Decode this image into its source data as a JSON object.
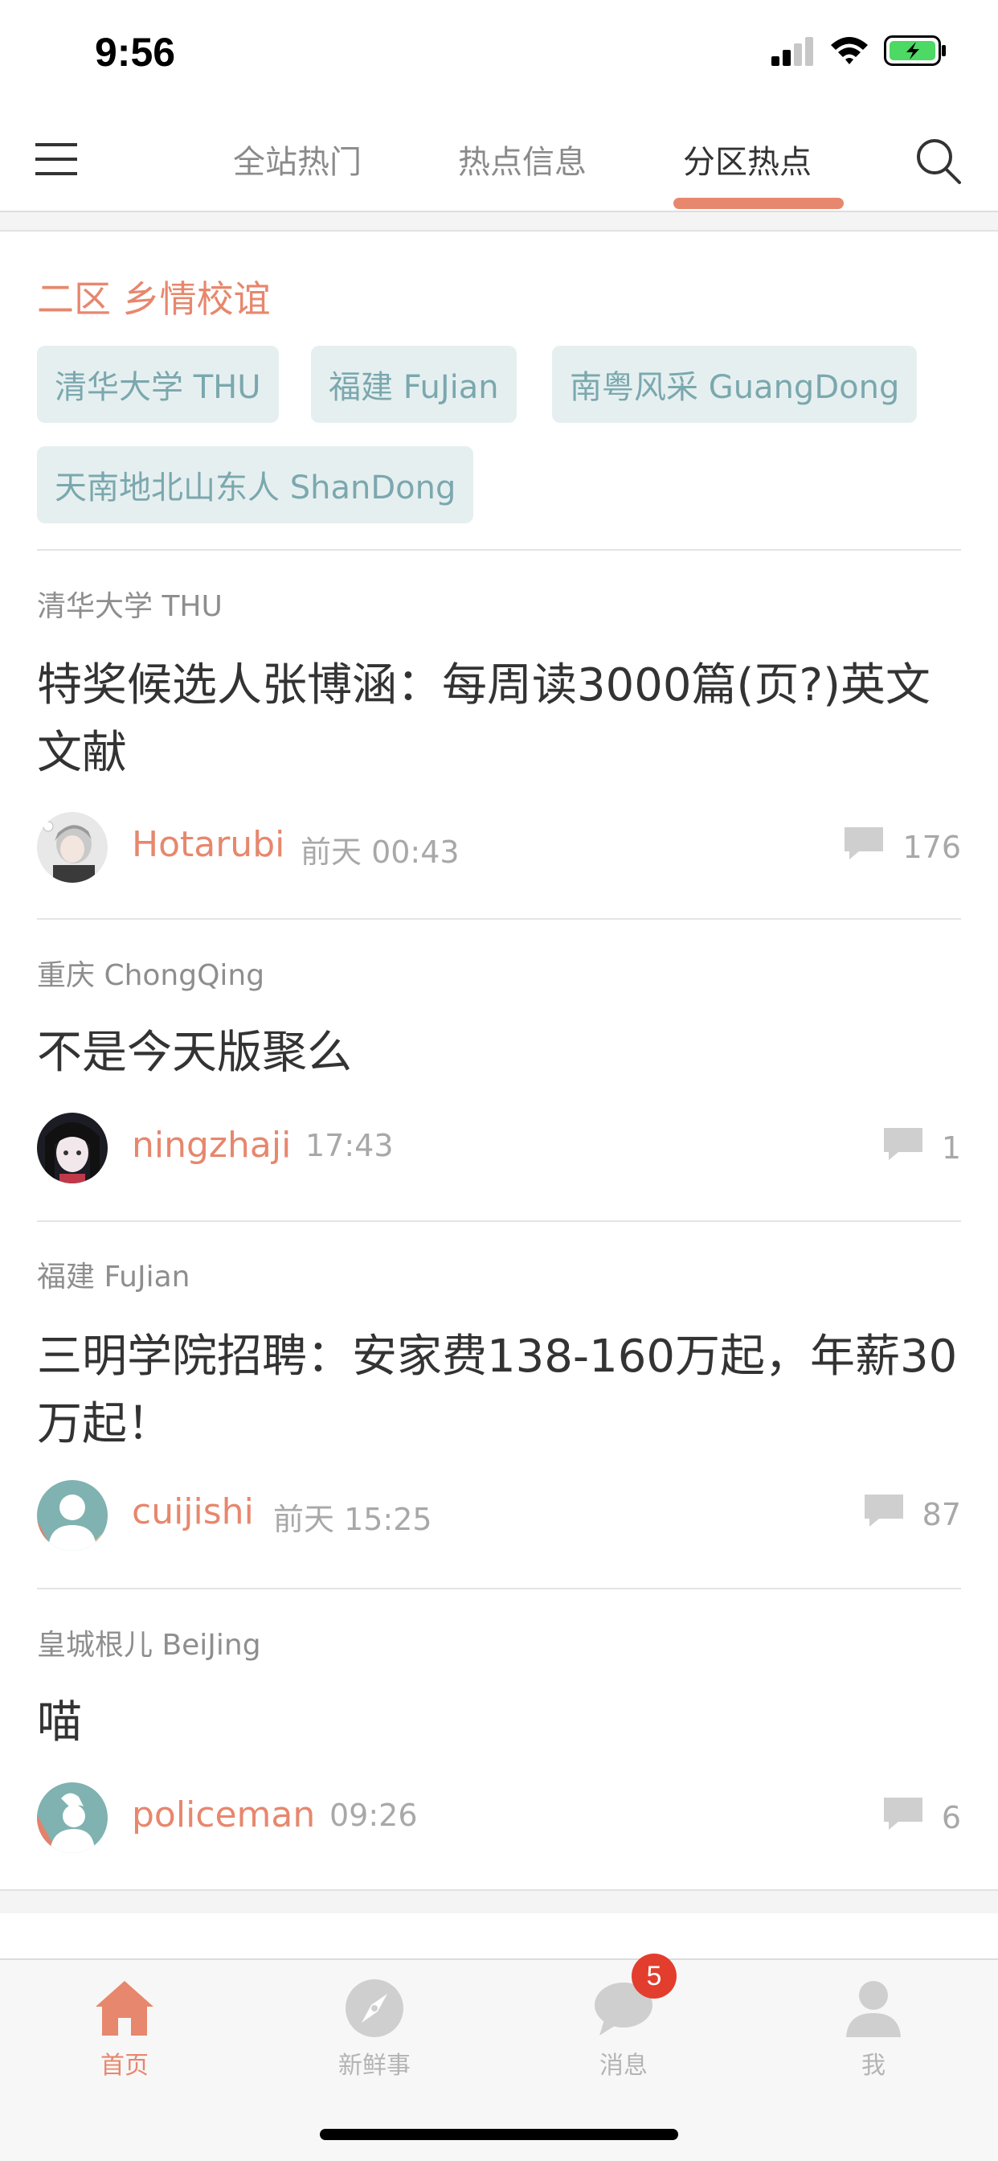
{
  "status_bar": {
    "time": "9:56"
  },
  "top_nav": {
    "tabs": [
      {
        "label": "全站热门",
        "active": false
      },
      {
        "label": "热点信息",
        "active": false
      },
      {
        "label": "分区热点",
        "active": true
      }
    ]
  },
  "section": {
    "title": "二区 乡情校谊",
    "tags": [
      "清华大学 THU",
      "福建 FuJian",
      "南粤风采 GuangDong",
      "天南地北山东人 ShanDong"
    ]
  },
  "posts": [
    {
      "board": "清华大学 THU",
      "title": "特奖候选人张博涵：每周读3000篇(页?)英文文献",
      "author": "Hotarubi",
      "time": "前天 00:43",
      "comments": "176"
    },
    {
      "board": "重庆 ChongQing",
      "title": "不是今天版聚么",
      "author": "ningzhaji",
      "time": "17:43",
      "comments": "1"
    },
    {
      "board": "福建 FuJian",
      "title": "三明学院招聘：安家费138-160万起，年薪30万起！",
      "author": "cuijishi",
      "time": "前天 15:25",
      "comments": "87"
    },
    {
      "board": "皇城根儿 BeiJing",
      "title": "喵",
      "author": "policeman",
      "time": "09:26",
      "comments": "6"
    }
  ],
  "tab_bar": {
    "items": [
      {
        "label": "首页",
        "icon": "home-icon",
        "active": true
      },
      {
        "label": "新鲜事",
        "icon": "compass-icon",
        "active": false
      },
      {
        "label": "消息",
        "icon": "message-icon",
        "active": false,
        "badge": "5"
      },
      {
        "label": "我",
        "icon": "person-icon",
        "active": false
      }
    ]
  },
  "colors": {
    "accent": "#e7876d",
    "tag_bg": "#e6eff0",
    "tag_text": "#7aa8ae",
    "badge": "#e33d2e"
  }
}
